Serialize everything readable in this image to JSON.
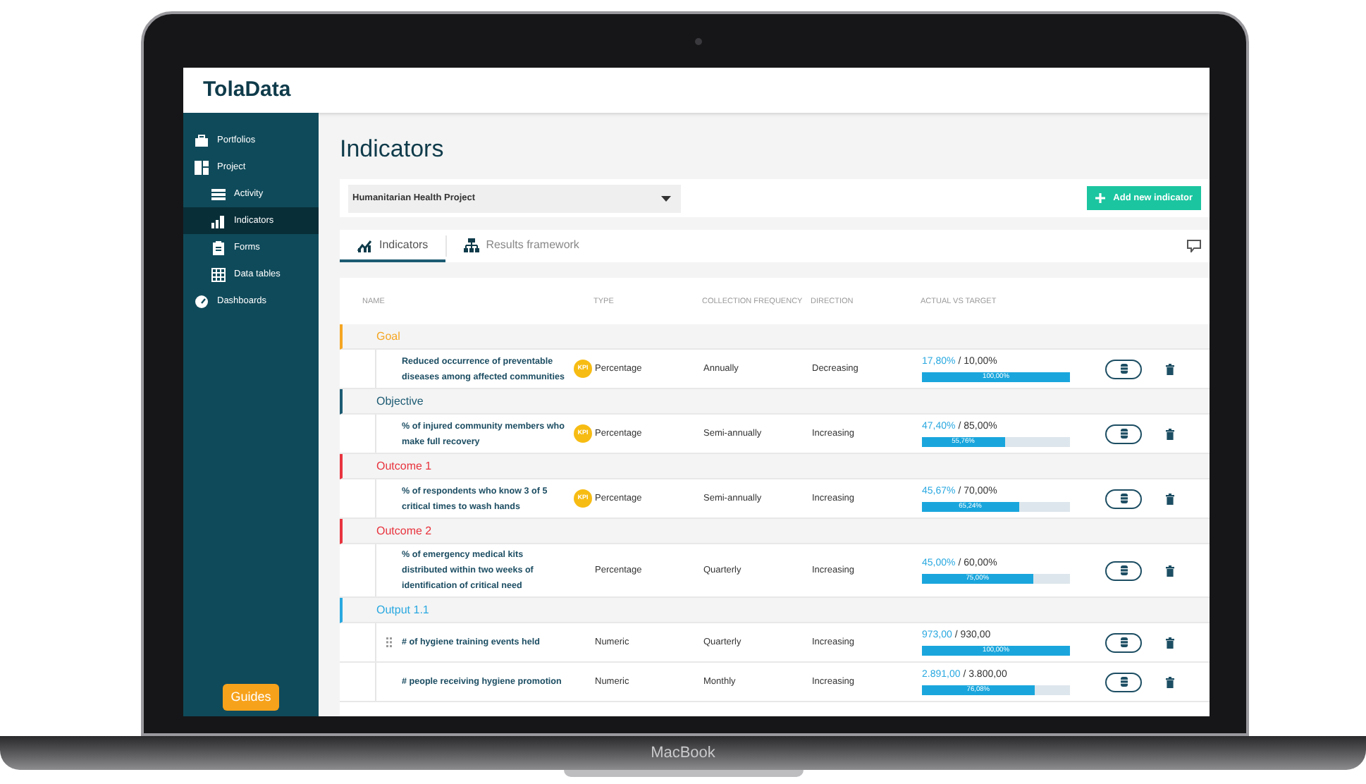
{
  "device": {
    "label": "MacBook"
  },
  "app": {
    "logo": "TolaData"
  },
  "sidebar": {
    "items": [
      {
        "label": "Portfolios",
        "selected": false
      },
      {
        "label": "Project",
        "selected": false,
        "children": [
          {
            "label": "Activity",
            "selected": false
          },
          {
            "label": "Indicators",
            "selected": true
          },
          {
            "label": "Forms",
            "selected": false
          },
          {
            "label": "Data tables",
            "selected": false
          }
        ]
      },
      {
        "label": "Dashboards",
        "selected": false
      }
    ],
    "guides_button": "Guides"
  },
  "page": {
    "title": "Indicators",
    "project_select": {
      "value": "Humanitarian Health Project"
    },
    "add_button": "Add new indicator"
  },
  "tabs": [
    {
      "label": "Indicators",
      "selected": true
    },
    {
      "label": "Results framework",
      "selected": false
    }
  ],
  "table": {
    "columns": [
      "NAME",
      "TYPE",
      "COLLECTION FREQUENCY",
      "DIRECTION",
      "ACTUAL VS TARGET"
    ],
    "groups": [
      {
        "label": "Goal",
        "color": "#f5a623",
        "indicators": [
          {
            "name": "Reduced occurrence of preventable diseases among affected communities",
            "kpi": true,
            "kpi_label": "KPI",
            "type": "Percentage",
            "frequency": "Annually",
            "direction": "Decreasing",
            "actual": "17,80%",
            "separator": "/",
            "target": "10,00%",
            "level": 1,
            "percent": "100,00%",
            "drag_handle": false
          }
        ]
      },
      {
        "label": "Objective",
        "color": "#1d5b73",
        "indicators": [
          {
            "name": "% of injured community members who make full recovery",
            "kpi": true,
            "kpi_label": "KPI",
            "type": "Percentage",
            "frequency": "Semi-annually",
            "direction": "Increasing",
            "actual": "47,40%",
            "separator": "/",
            "target": "85,00%",
            "level": 0.5576,
            "percent": "55,76%",
            "drag_handle": false
          }
        ]
      },
      {
        "label": "Outcome 1",
        "color": "#e8343e",
        "indicators": [
          {
            "name": "% of respondents who know 3 of 5 critical times to wash hands",
            "kpi": true,
            "kpi_label": "KPI",
            "type": "Percentage",
            "frequency": "Semi-annually",
            "direction": "Increasing",
            "actual": "45,67%",
            "separator": "/",
            "target": "70,00%",
            "level": 0.6524,
            "percent": "65,24%",
            "drag_handle": false
          }
        ]
      },
      {
        "label": "Outcome 2",
        "color": "#e8343e",
        "indicators": [
          {
            "name": "% of emergency medical kits distributed within two weeks of identification of critical need",
            "kpi": false,
            "type": "Percentage",
            "frequency": "Quarterly",
            "direction": "Increasing",
            "actual": "45,00%",
            "separator": "/",
            "target": "60,00%",
            "level": 0.75,
            "percent": "75,00%",
            "drag_handle": false
          }
        ]
      },
      {
        "label": "Output 1.1",
        "color": "#29a8e0",
        "indicators": [
          {
            "name": "# of hygiene training events held",
            "kpi": false,
            "type": "Numeric",
            "frequency": "Quarterly",
            "direction": "Increasing",
            "actual": "973,00",
            "separator": "/",
            "target": "930,00",
            "level": 1,
            "percent": "100,00%",
            "drag_handle": true
          },
          {
            "name": "# people receiving hygiene promotion",
            "kpi": false,
            "type": "Numeric",
            "frequency": "Monthly",
            "direction": "Increasing",
            "actual": "2.891,00",
            "separator": "/",
            "target": "3.800,00",
            "level": 0.7608,
            "percent": "76,08%",
            "drag_handle": false
          }
        ]
      }
    ]
  }
}
